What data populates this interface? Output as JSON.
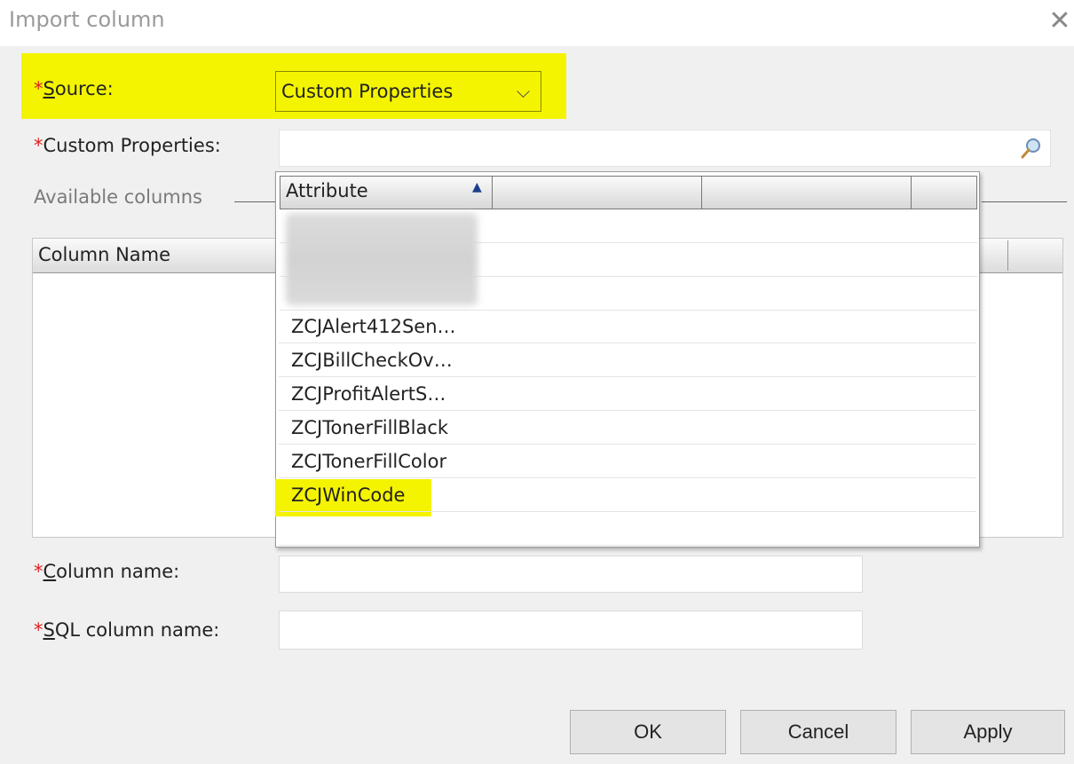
{
  "window": {
    "title": "Import column",
    "close_symbol": "✕"
  },
  "source": {
    "required_mark": "*",
    "access_key": "S",
    "label_rest": "ource:",
    "value": "Custom Properties",
    "chevron": "⌵"
  },
  "custom_properties": {
    "required_mark": "*",
    "label": "Custom Properties:",
    "value": "",
    "icon": "search-icon"
  },
  "available_columns": {
    "label": "Available columns",
    "header": "Column Name"
  },
  "dropdown": {
    "header": "Attribute",
    "sort_indicator": "▲",
    "items": [
      "ZCJAlert412Sen…",
      "ZCJBillCheckOv…",
      "ZCJProfitAlertS…",
      "ZCJTonerFillBlack",
      "ZCJTonerFillColor",
      "ZCJWinCode"
    ],
    "selected": "ZCJWinCode"
  },
  "column_name": {
    "required_mark": "*",
    "access_key": "C",
    "label_rest": "olumn name:",
    "value": ""
  },
  "sql_column_name": {
    "required_mark": "*",
    "access_key": "S",
    "label_rest": "QL column name:",
    "value": ""
  },
  "buttons": {
    "ok": "OK",
    "cancel": "Cancel",
    "apply": "Apply"
  },
  "colors": {
    "highlight": "#f4f400",
    "required": "#e02020"
  }
}
